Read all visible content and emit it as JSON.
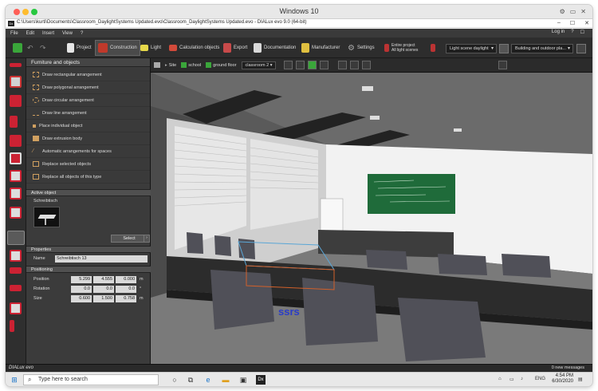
{
  "mac": {
    "title": "Windows 10",
    "toolbar_icons": [
      "settings-icon",
      "window-icon",
      "close-icon"
    ]
  },
  "app": {
    "title": "C:\\Users\\kurti\\Documents\\Classroom_DaylightSystems Updated.evo\\Classroom_DaylightSystems Updated.evo - DIALux evo 9.0  (64-bit)",
    "icon_text": "Dx",
    "controls": [
      "–",
      "☐",
      "✕"
    ]
  },
  "menubar": {
    "items": [
      "File",
      "Edit",
      "Insert",
      "View",
      "?"
    ],
    "login": "Log in",
    "right_icons": [
      "?",
      "☐"
    ]
  },
  "toolbar": {
    "tabs": [
      {
        "label": "Project",
        "icon": "document-icon"
      },
      {
        "label": "Construction",
        "icon": "wall-icon"
      },
      {
        "label": "Light",
        "icon": "lamp-icon"
      },
      {
        "label": "Calculation objects",
        "icon": "ruler-icon"
      },
      {
        "label": "Export",
        "icon": "export-icon"
      },
      {
        "label": "Documentation",
        "icon": "documentation-icon"
      },
      {
        "label": "Manufacturer",
        "icon": "manufacturer-icon"
      },
      {
        "label": "Settings",
        "icon": "gear-icon"
      }
    ],
    "active_tab": "Construction",
    "calc_line1": "Entire project",
    "calc_line2": "All light scenes",
    "light_scene": "Light scene daylight",
    "view_mode": "Building and outdoor pla..."
  },
  "panel": {
    "header": "Furniture and objects",
    "items": [
      "Draw rectangular arrangement",
      "Draw polygonal arrangement",
      "Draw circular arrangement",
      "Draw line arrangement",
      "Place individual object",
      "Draw extrusion body",
      "Automatic arrangements for spaces",
      "Replace selected objects",
      "Replace all objects of this type"
    ],
    "active_object": {
      "header": "Active object",
      "name": "Schreibtisch",
      "select_label": "Select"
    },
    "properties": {
      "header": "Properties",
      "name_label": "Name",
      "name_value": "Schreibtisch 13"
    },
    "positioning": {
      "header": "Positioning",
      "rows": [
        {
          "label": "Position",
          "values": [
            "5.299",
            "4.555",
            "0.000"
          ],
          "unit": "m"
        },
        {
          "label": "Rotation",
          "values": [
            "0.0",
            "0.0",
            "0.0"
          ],
          "unit": "°"
        },
        {
          "label": "Size",
          "values": [
            "0.600",
            "1.500",
            "0.758"
          ],
          "unit": "m"
        }
      ]
    }
  },
  "view": {
    "crumbs": [
      "Site",
      "school",
      "ground floor"
    ],
    "room": "classroom 2"
  },
  "status": {
    "logo": "DIALux evo",
    "messages": "0 new messages"
  },
  "taskbar": {
    "search_placeholder": "Type here to search",
    "time": "4:54 PM",
    "date": "6/30/2020",
    "lang": "ENG"
  },
  "colors": {
    "accent_green": "#3aa63a",
    "accent_red": "#d23a2a",
    "chalkboard": "#1f6b3a",
    "panel": "#3b3b3b"
  }
}
